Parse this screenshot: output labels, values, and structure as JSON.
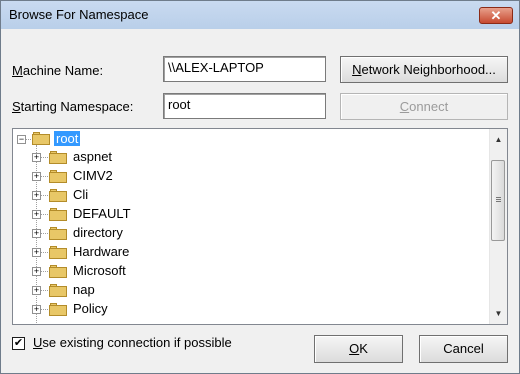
{
  "window": {
    "title": "Browse For Namespace",
    "close_glyph": "✕"
  },
  "form": {
    "machine_label": "Machine Name:",
    "machine_label_mnemonic": "M",
    "machine_label_rest": "achine Name:",
    "machine_value": "\\\\ALEX-LAPTOP",
    "network_button": "Network Neighborhood...",
    "network_mnemonic": "N",
    "network_rest": "etwork Neighborhood...",
    "namespace_label_mnemonic": "S",
    "namespace_label_rest": "tarting Namespace:",
    "namespace_value": "root",
    "connect_mnemonic": "C",
    "connect_rest": "onnect"
  },
  "tree": {
    "root": "root",
    "children": [
      "aspnet",
      "CIMV2",
      "Cli",
      "DEFAULT",
      "directory",
      "Hardware",
      "Microsoft",
      "nap",
      "Policy"
    ],
    "expand_glyph": "+",
    "collapse_glyph": "−"
  },
  "footer": {
    "checkbox_checked": true,
    "checkbox_glyph": "✔",
    "checkbox_mnemonic": "U",
    "checkbox_rest": "se existing connection if possible",
    "ok_mnemonic": "O",
    "ok_rest": "K",
    "cancel": "Cancel"
  },
  "scrollbar": {
    "up": "▲",
    "down": "▼"
  }
}
